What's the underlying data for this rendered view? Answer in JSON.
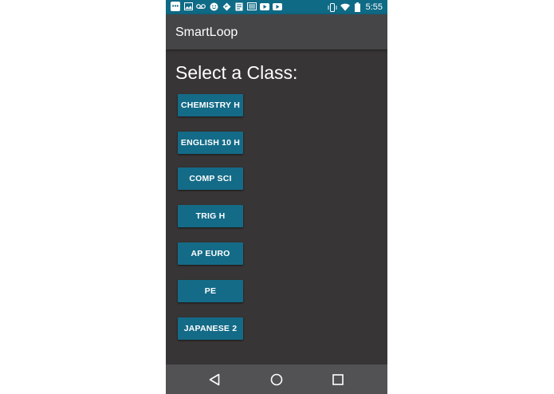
{
  "status_bar": {
    "time": "5:55",
    "left_icons": [
      "chat-icon",
      "image-icon",
      "voicemail-icon",
      "smiley-icon",
      "navigation-icon",
      "document-icon",
      "newspaper-icon",
      "youtube-icon",
      "youtube-icon"
    ],
    "right_icons": [
      "vibrate-icon",
      "wifi-icon",
      "battery-icon"
    ]
  },
  "app_bar": {
    "title": "SmartLoop"
  },
  "main": {
    "heading": "Select a Class:",
    "classes": [
      {
        "label": "CHEMISTRY H"
      },
      {
        "label": "ENGLISH 10 H"
      },
      {
        "label": "COMP SCI"
      },
      {
        "label": "TRIG H"
      },
      {
        "label": "AP EURO"
      },
      {
        "label": "PE"
      },
      {
        "label": "JAPANESE 2"
      }
    ]
  },
  "nav_bar": {
    "icons": [
      "back-icon",
      "home-icon",
      "recents-icon"
    ]
  },
  "colors": {
    "status_bar": "#0f6a85",
    "app_bar": "#454547",
    "background": "#373535",
    "button": "#146b87",
    "nav_bar": "#525154"
  }
}
